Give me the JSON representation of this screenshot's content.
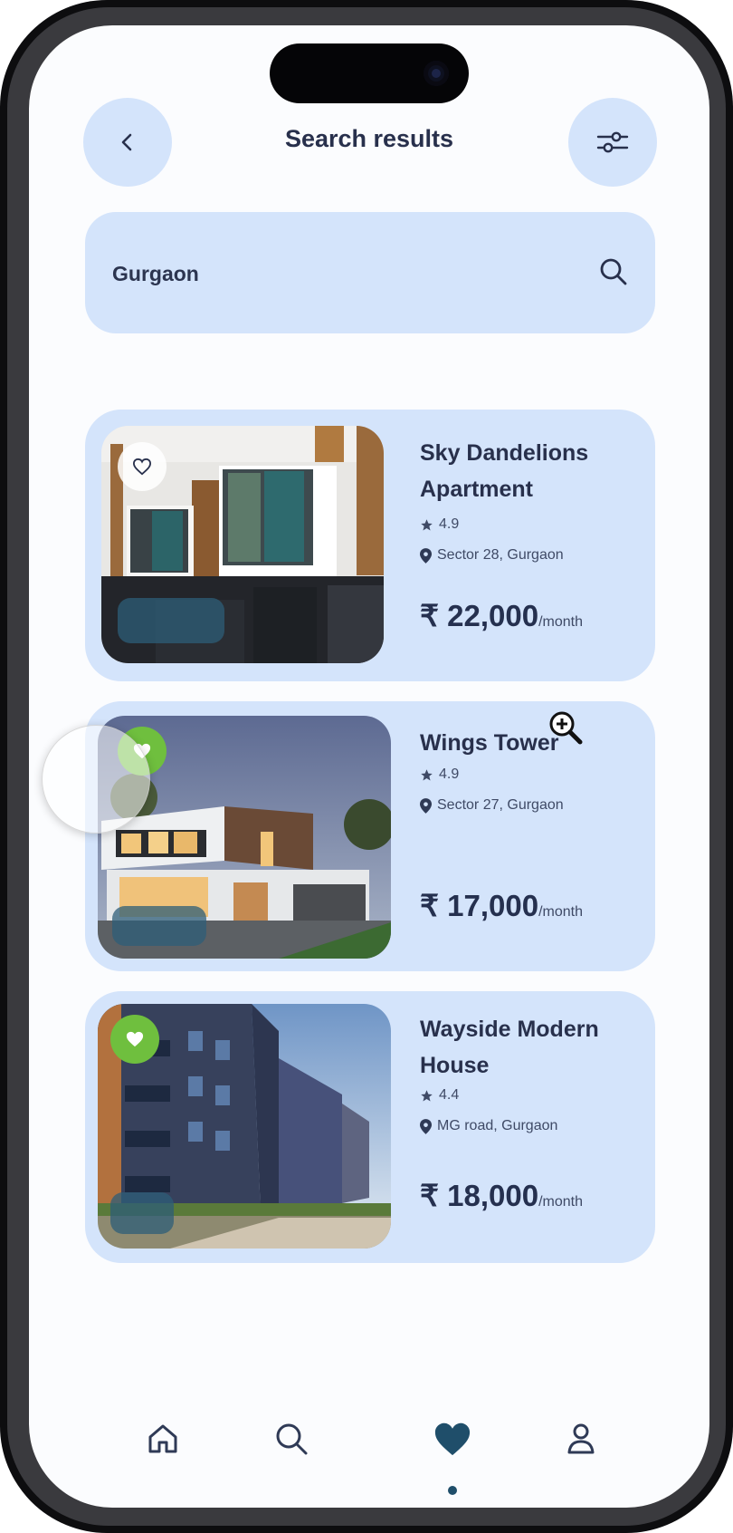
{
  "header": {
    "title": "Search results",
    "back_icon": "chevron-left-icon",
    "filter_icon": "sliders-icon"
  },
  "search": {
    "value": "Gurgaon",
    "icon": "search-icon"
  },
  "listings": [
    {
      "title_line1": "Sky Dandelions",
      "title_line2": "Apartment",
      "rating": "4.9",
      "location": "Sector 28, Gurgaon",
      "price": "₹ 22,000",
      "price_unit": "/month",
      "favorite": false
    },
    {
      "title_line1": "Wings Tower",
      "title_line2": "",
      "rating": "4.9",
      "location": "Sector 27, Gurgaon",
      "price": "₹ 17,000",
      "price_unit": "/month",
      "favorite": true
    },
    {
      "title_line1": "Wayside Modern",
      "title_line2": "House",
      "rating": "4.4",
      "location": "MG road, Gurgaon",
      "price": "₹ 18,000",
      "price_unit": "/month",
      "favorite": true
    }
  ],
  "bottom_nav": {
    "items": [
      "home-icon",
      "search-icon",
      "heart-icon",
      "user-icon"
    ],
    "active": "heart-icon"
  },
  "colors": {
    "card_bg": "#d4e4fb",
    "accent_dark": "#1f4e6a",
    "favorite_green": "#6fbf3e",
    "text_dark": "#28304c"
  }
}
